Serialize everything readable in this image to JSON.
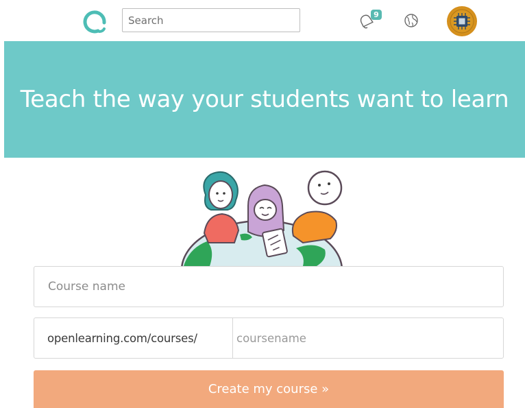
{
  "topbar": {
    "search": {
      "placeholder": "Search",
      "value": ""
    },
    "notifications": {
      "count": "9",
      "icon": "bell-icon"
    },
    "language_icon": "globe-icon",
    "avatar_icon": "chip-avatar"
  },
  "hero": {
    "title": "Teach the way your students want to learn",
    "background": "#6ec9c8"
  },
  "illustration": {
    "name": "students-around-globe-illustration"
  },
  "form": {
    "course_name": {
      "placeholder": "Course name",
      "value": ""
    },
    "url_prefix": "openlearning.com/courses/",
    "course_slug": {
      "placeholder": "coursename",
      "value": ""
    },
    "submit_label": "Create my course »",
    "submit_color": "#f2a97d"
  }
}
